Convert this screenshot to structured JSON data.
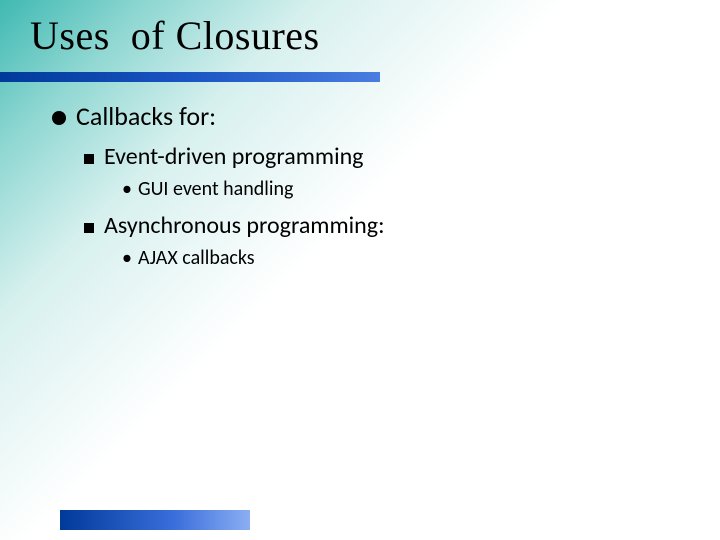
{
  "title": "Uses  of Closures",
  "list": {
    "level1": {
      "text": "Callbacks for:",
      "children": [
        {
          "text": "Event-driven programming",
          "children": [
            {
              "text": "GUI event handling"
            }
          ]
        },
        {
          "text": "Asynchronous programming:",
          "children": [
            {
              "text": "AJAX callbacks"
            }
          ]
        }
      ]
    }
  }
}
